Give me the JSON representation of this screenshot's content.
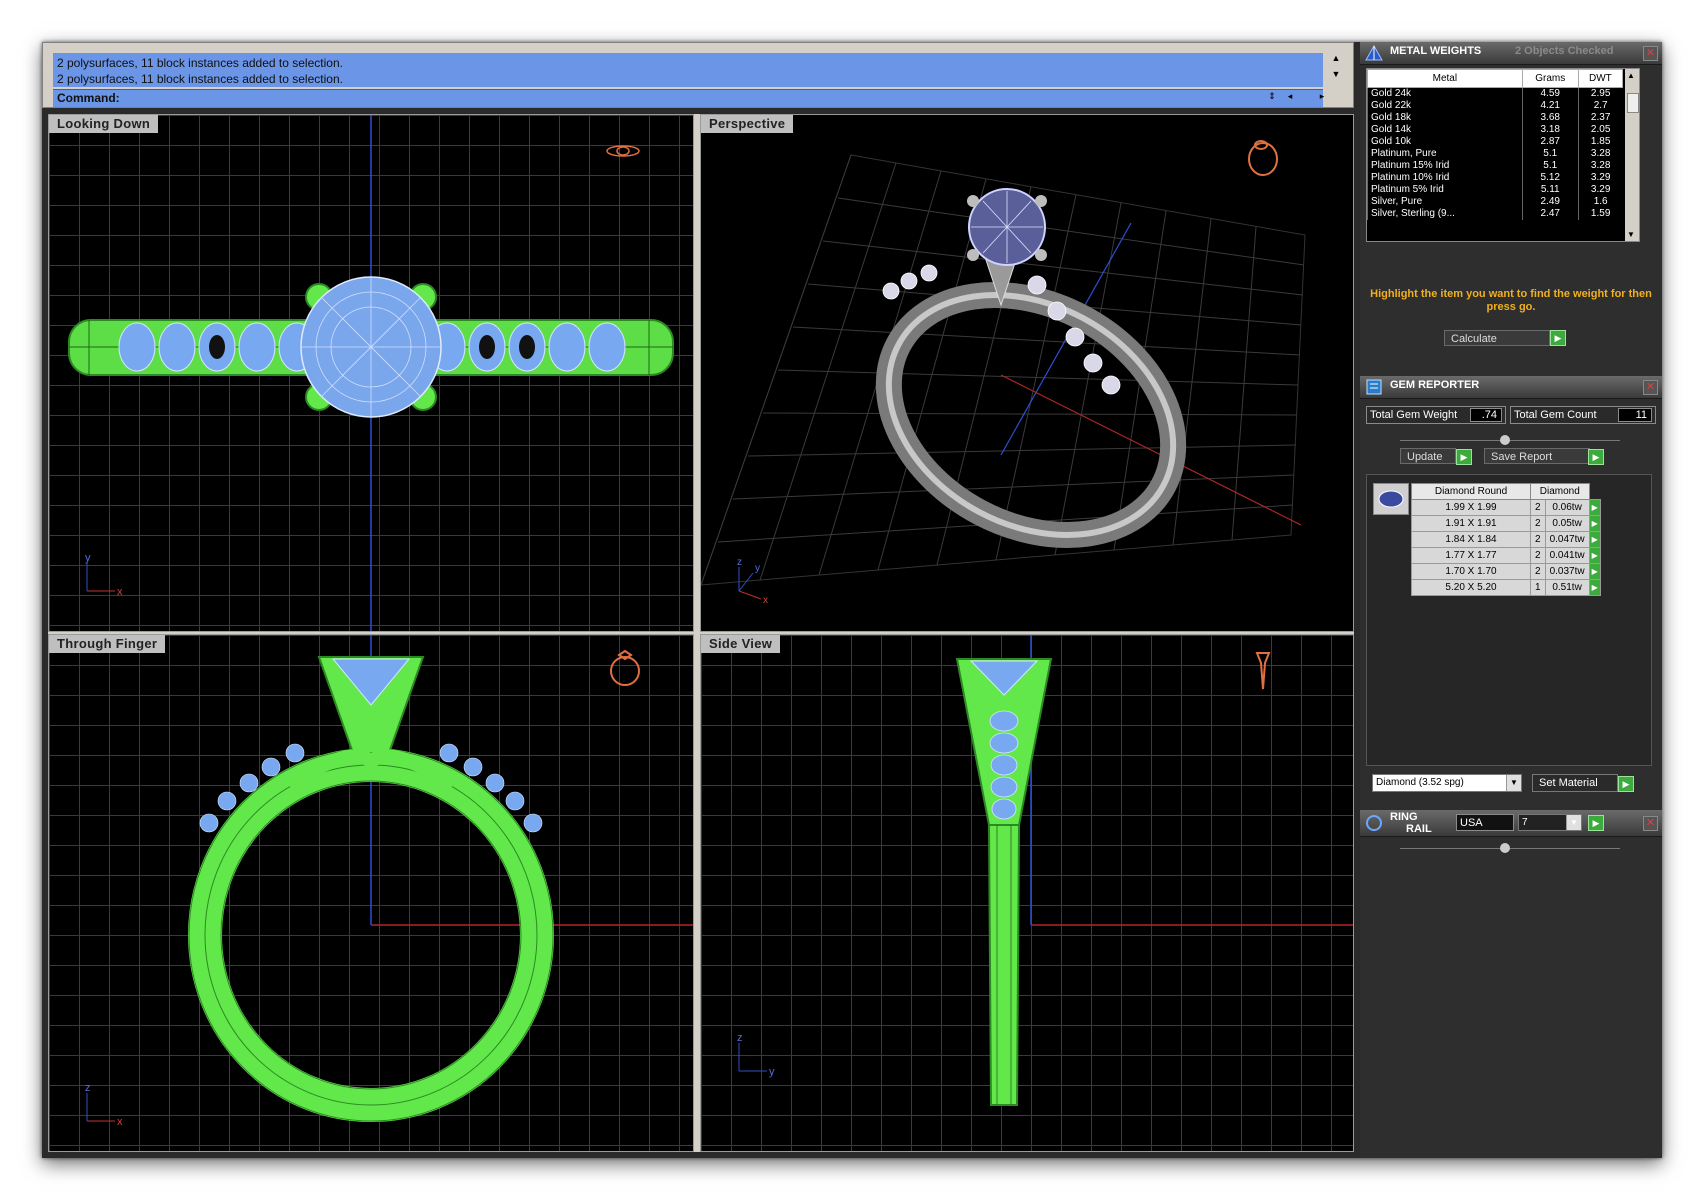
{
  "command": {
    "history": [
      "2 polysurfaces, 11 block instances added to selection.",
      "2 polysurfaces, 11 block instances added to selection."
    ],
    "prompt_label": "Command:",
    "input_value": ""
  },
  "viewports": [
    {
      "label": "Looking Down",
      "axis_a": "y",
      "axis_b": "x"
    },
    {
      "label": "Perspective",
      "axis_a": "z",
      "axis_b": "y",
      "axis_c": "x"
    },
    {
      "label": "Through Finger",
      "axis_a": "z",
      "axis_b": "x"
    },
    {
      "label": "Side View",
      "axis_a": "z",
      "axis_b": "y"
    }
  ],
  "metal_weights": {
    "title": "METAL WEIGHTS",
    "status": "2 Objects Checked",
    "close_glyph": "✕",
    "columns": [
      "Metal",
      "Grams",
      "DWT"
    ],
    "rows": [
      [
        "Gold 24k",
        "4.59",
        "2.95"
      ],
      [
        "Gold 22k",
        "4.21",
        "2.7"
      ],
      [
        "Gold 18k",
        "3.68",
        "2.37"
      ],
      [
        "Gold 14k",
        "3.18",
        "2.05"
      ],
      [
        "Gold 10k",
        "2.87",
        "1.85"
      ],
      [
        "Platinum, Pure",
        "5.1",
        "3.28"
      ],
      [
        "Platinum 15% Irid",
        "5.1",
        "3.28"
      ],
      [
        "Platinum 10% Irid",
        "5.12",
        "3.29"
      ],
      [
        "Platinum 5% Irid",
        "5.11",
        "3.29"
      ],
      [
        "Silver, Pure",
        "2.49",
        "1.6"
      ],
      [
        "Silver, Sterling (9...",
        "2.47",
        "1.59"
      ]
    ],
    "hint": "Highlight the item you want to find the weight for then press go.",
    "calculate_label": "Calculate"
  },
  "gem_reporter": {
    "title": "GEM REPORTER",
    "close_glyph": "✕",
    "total_weight_label": "Total Gem Weight",
    "total_weight_value": ".74",
    "total_count_label": "Total Gem Count",
    "total_count_value": "11",
    "update_label": "Update",
    "save_report_label": "Save Report",
    "table_header": [
      "Diamond Round",
      "Diamond"
    ],
    "rows": [
      [
        "1.99 X 1.99",
        "2",
        "0.06tw"
      ],
      [
        "1.91 X 1.91",
        "2",
        "0.05tw"
      ],
      [
        "1.84 X 1.84",
        "2",
        "0.047tw"
      ],
      [
        "1.77 X 1.77",
        "2",
        "0.041tw"
      ],
      [
        "1.70 X 1.70",
        "2",
        "0.037tw"
      ],
      [
        "5.20 X 5.20",
        "1",
        "0.51tw"
      ]
    ],
    "material_select": "Diamond    (3.52 spg)",
    "set_material_label": "Set Material"
  },
  "ring_rail": {
    "title_line1": "RING",
    "title_line2": "RAIL",
    "region_value": "USA",
    "size_value": "7",
    "close_glyph": "✕"
  },
  "colors": {
    "wire_green": "#62e84a",
    "wire_blue": "#78a8f0",
    "command_blue": "#6b95e6",
    "hint_orange": "#f0b020"
  }
}
